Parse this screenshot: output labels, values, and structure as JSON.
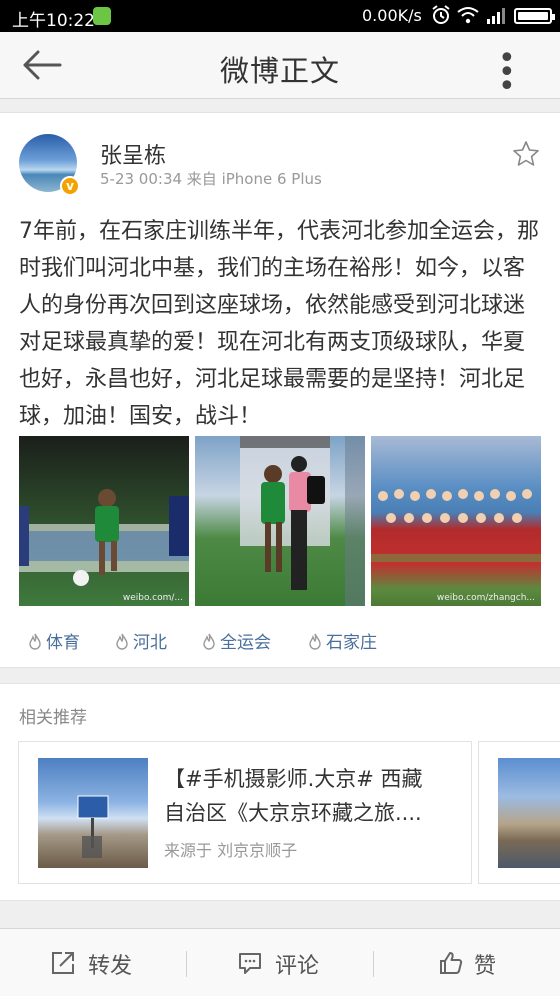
{
  "status": {
    "time": "上午10:22",
    "speed": "0.00K/s"
  },
  "nav": {
    "title": "微博正文",
    "more": "• • •"
  },
  "post": {
    "author": "张呈栋",
    "verified": "v",
    "meta": "5-23 00:34  来自 iPhone 6 Plus",
    "text": "7年前，在石家庄训练半年，代表河北参加全运会，那时我们叫河北中基，我们的主场在裕彤！如今，以客人的身份再次回到这座球场，依然能感受到河北球迷对足球最真挚的爱！现在河北有两支顶级球队，华夏也好，永昌也好，河北足球最需要的是坚持！河北足球，加油！国安，战斗！",
    "photo_watermarks": [
      "weibo.com/...",
      "",
      "weibo.com/zhangch..."
    ],
    "tags": [
      "体育",
      "河北",
      "全运会",
      "石家庄"
    ]
  },
  "related": {
    "title": "相关推荐",
    "card": {
      "line1": "【#手机摄影师.大京# 西藏",
      "line2": "自治区《大京京环藏之旅....",
      "source": "来源于 刘京京顺子"
    }
  },
  "actions": {
    "repost": "转发",
    "comment": "评论",
    "like": "赞"
  },
  "colors": {
    "tag": "#4a6f9c",
    "badge": "#f4a200",
    "statusbar": "#000000"
  }
}
